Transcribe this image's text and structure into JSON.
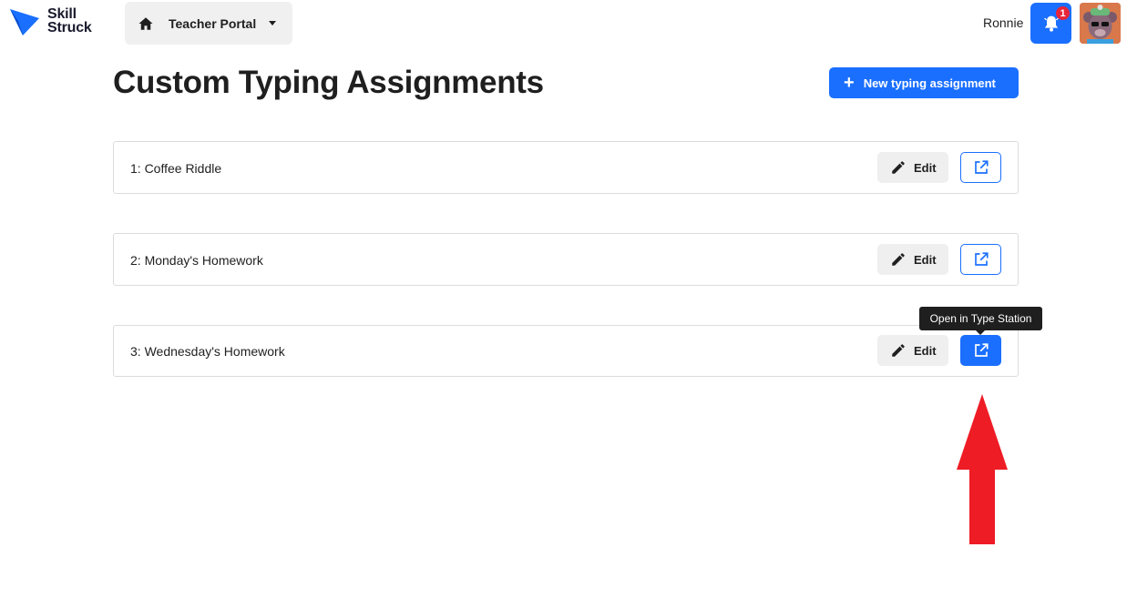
{
  "header": {
    "logo_line1": "Skill",
    "logo_line2": "Struck",
    "portal_label": "Teacher Portal",
    "username": "Ronnie",
    "notification_count": "1"
  },
  "main": {
    "title": "Custom Typing Assignments",
    "new_button_label": "New typing assignment",
    "assignments": [
      {
        "title": "1: Coffee Riddle",
        "edit_label": "Edit"
      },
      {
        "title": "2: Monday's Homework",
        "edit_label": "Edit"
      },
      {
        "title": "3: Wednesday's Homework",
        "edit_label": "Edit"
      }
    ],
    "tooltip": "Open in Type Station"
  },
  "colors": {
    "accent": "#1a6fff",
    "badge": "#e8253a",
    "annotation_arrow": "#ee1c25"
  },
  "icons": {
    "logo": "skill-struck-logo-icon",
    "home": "home-icon",
    "caret": "caret-down-icon",
    "bell": "bell-icon",
    "plus": "plus-icon",
    "edit": "pencil-icon",
    "open": "external-link-icon"
  }
}
